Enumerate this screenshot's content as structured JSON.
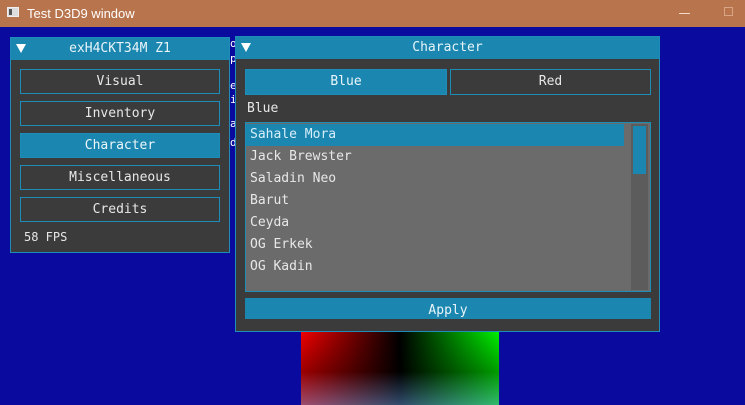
{
  "titlebar": {
    "title": "Test D3D9 window"
  },
  "stray_text": [
    "o",
    "p",
    "e",
    "i",
    "a",
    "d"
  ],
  "main_menu": {
    "title": "exH4CKT34M Z1",
    "buttons": [
      {
        "label": "Visual",
        "active": false
      },
      {
        "label": "Inventory",
        "active": false
      },
      {
        "label": "Character",
        "active": true
      },
      {
        "label": "Miscellaneous",
        "active": false
      },
      {
        "label": "Credits",
        "active": false
      }
    ],
    "fps": "58 FPS"
  },
  "character": {
    "title": "Character",
    "tabs": [
      {
        "label": "Blue",
        "active": true
      },
      {
        "label": "Red",
        "active": false
      }
    ],
    "team_label": "Blue",
    "list": {
      "items": [
        "Sahale Mora",
        "Jack Brewster",
        "Saladin Neo",
        "Barut",
        "Ceyda",
        "OG Erkek",
        "OG Kadin"
      ],
      "selected_index": 0
    },
    "apply_label": "Apply"
  },
  "colors": {
    "accent": "#1b87b0",
    "panel": "#3b3b3b",
    "background": "#0a0a9e",
    "titlebar": "#b8744c"
  },
  "icons": {
    "collapse": "triangle-down-icon",
    "app": "window-icon"
  }
}
